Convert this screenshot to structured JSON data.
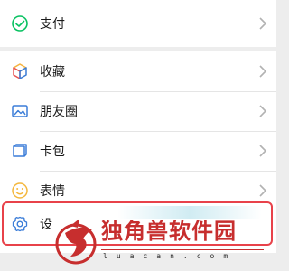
{
  "menu": {
    "pay": {
      "label": "支付",
      "icon": "pay-icon"
    },
    "favorites": {
      "label": "收藏",
      "icon": "cube-icon"
    },
    "moments": {
      "label": "朋友圈",
      "icon": "image-icon"
    },
    "cards": {
      "label": "卡包",
      "icon": "wallet-icon"
    },
    "stickers": {
      "label": "表情",
      "icon": "smile-icon"
    },
    "settings": {
      "label": "设",
      "icon": "gear-icon"
    }
  },
  "watermark": {
    "title": "独角兽软件园",
    "subtitle": "luacan.com"
  },
  "colors": {
    "highlight": "#e8424a",
    "pay_green": "#07c160",
    "favorites_multi": [
      "#f6b23c",
      "#e85454",
      "#3a7bd5"
    ],
    "moments_blue": "#3b7dd8",
    "cards_blue": "#3b7dd8",
    "stickers_yellow": "#f4b73c",
    "settings_blue": "#3b7dd8",
    "watermark_red": "#c72e2e"
  }
}
